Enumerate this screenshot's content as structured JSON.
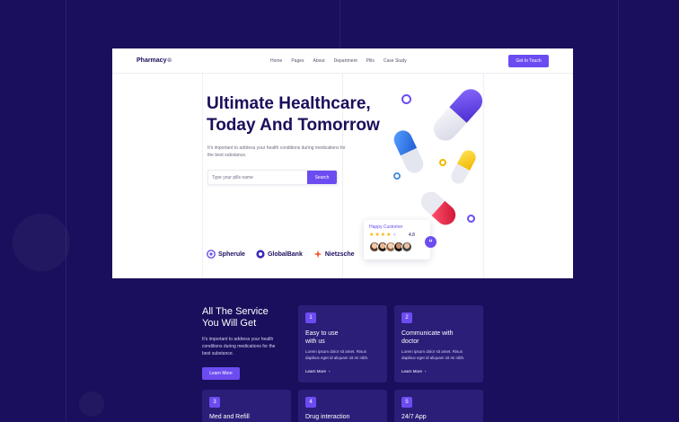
{
  "nav": {
    "logo": "Pharmacy",
    "logo_mark": "©",
    "links": [
      "Home",
      "Pages",
      "About",
      "Department",
      "Pills",
      "Case Study"
    ],
    "cta": "Get In Touch"
  },
  "hero": {
    "title_line1": "Ultimate Healthcare,",
    "title_line2": "Today And Tomorrow",
    "description": "It's important to address your health conditions during medications for the best substance.",
    "search": {
      "placeholder": "Type your pills name",
      "button": "Search"
    },
    "brands": [
      "Spherule",
      "GlobalBank",
      "Nietzsche"
    ],
    "review": {
      "title": "Happy Customer",
      "rating": "4.8",
      "stars_filled": 4,
      "stars_total": 5,
      "quote_mark": "“"
    }
  },
  "services": {
    "title_line1": "All The Service",
    "title_line2": "You Will Get",
    "description": "It's important to address your health conditions during medications for the best substance.",
    "button": "Learn More",
    "cards": [
      {
        "number": "1",
        "title_line1": "Easy to use",
        "title_line2": "with us",
        "text": "Lorem ipsum dolor sit amet. Risus dapibus eget id aliquam sit mi nibh.",
        "link": "Learn More"
      },
      {
        "number": "2",
        "title_line1": "Communicate with",
        "title_line2": "doctor",
        "text": "Lorem ipsum dolor sit amet. Risus dapibus eget id aliquam sit mi nibh.",
        "link": "Learn More"
      },
      {
        "number": "3",
        "title_line1": "Med and Refill",
        "title_line2": "",
        "text": "",
        "link": ""
      },
      {
        "number": "4",
        "title_line1": "Drug interaction",
        "title_line2": "",
        "text": "",
        "link": ""
      },
      {
        "number": "5",
        "title_line1": "24/7 App",
        "title_line2": "",
        "text": "",
        "link": ""
      }
    ],
    "arrow": "›"
  },
  "colors": {
    "background": "#1a0f5c",
    "accent": "#6c4cf1",
    "card": "#2a1e79",
    "star": "#f5b400"
  },
  "icons": [
    "spherule-icon",
    "globalbank-icon",
    "nietzsche-icon",
    "star-icon",
    "quote-icon",
    "arrow-right-icon"
  ]
}
